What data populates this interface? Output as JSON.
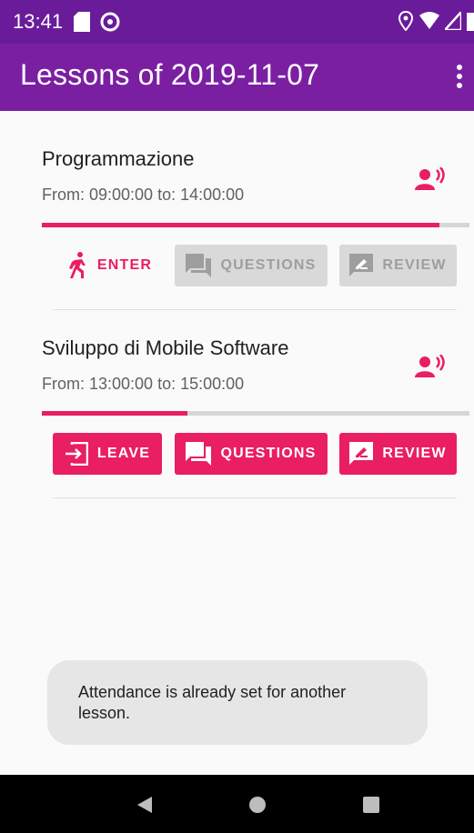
{
  "status_bar": {
    "time": "13:41"
  },
  "app_bar": {
    "title": "Lessons of 2019-11-07"
  },
  "lessons": [
    {
      "name": "Programmazione",
      "time_range": "From: 09:00:00 to: 14:00:00",
      "progress": 0.93,
      "buttons": {
        "attendance": "ENTER",
        "questions": "QUESTIONS",
        "review": "REVIEW"
      }
    },
    {
      "name": "Sviluppo di Mobile Software",
      "time_range": "From: 13:00:00 to: 15:00:00",
      "progress": 0.34,
      "buttons": {
        "attendance": "LEAVE",
        "questions": "QUESTIONS",
        "review": "REVIEW"
      }
    }
  ],
  "toast": {
    "message": "Attendance is already set for another lesson."
  },
  "colors": {
    "primary": "#7b1fa2",
    "primary_dark": "#6a1b9a",
    "accent": "#e91e63"
  },
  "icons": {
    "attendance_enter": "run-icon",
    "attendance_leave": "exit-icon",
    "questions": "forum-icon",
    "review": "rate-review-icon",
    "lesson_status": "record-voice-icon"
  }
}
